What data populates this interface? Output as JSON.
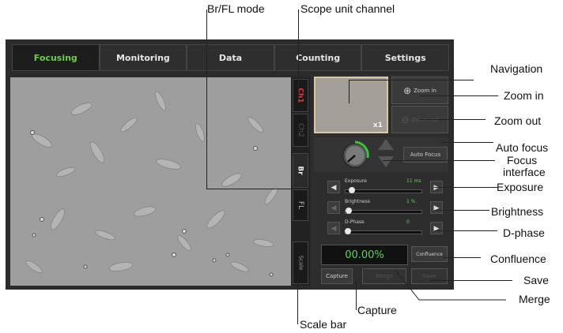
{
  "tabs": [
    "Focusing",
    "Monitoring",
    "Data",
    "Counting",
    "Settings"
  ],
  "channels": {
    "ch1": "Ch1",
    "ch2": "Ch2",
    "br": "Br",
    "fl": "FL",
    "scale": "Scale"
  },
  "navigation": {
    "zoom_level": "x1"
  },
  "zoom": {
    "in_label": "Zoom in",
    "out_label": "Zoom out"
  },
  "auto_focus_label": "Auto Focus",
  "sliders": [
    {
      "label": "Exposure",
      "value": "11 ms",
      "level": 0.06
    },
    {
      "label": "Brightness",
      "value": "1 %",
      "level": 0.01
    },
    {
      "label": "D-Phase",
      "value": "0",
      "level": 0.0
    }
  ],
  "confluence": {
    "value": "00.00%",
    "button": "Confluence"
  },
  "buttons": {
    "capture": "Capture",
    "merge": "Merge",
    "save": "Save"
  },
  "callouts": {
    "br_fl_mode": "Br/FL mode",
    "scope_unit_channel": "Scope unit channel",
    "navigation": "Navigation",
    "zoom_in": "Zoom in",
    "zoom_out": "Zoom out",
    "auto_focus": "Auto focus",
    "focus_interface_1": "Focus",
    "focus_interface_2": "interface",
    "exposure": "Exposure",
    "brightness": "Brightness",
    "d_phase": "D-phase",
    "confluence": "Confluence",
    "save": "Save",
    "merge": "Merge",
    "capture": "Capture",
    "scale_bar": "Scale bar"
  },
  "colors": {
    "active_tab": "#6ecb4c",
    "channel_red": "#e03a3a",
    "confluence_green": "#5fd35a"
  }
}
